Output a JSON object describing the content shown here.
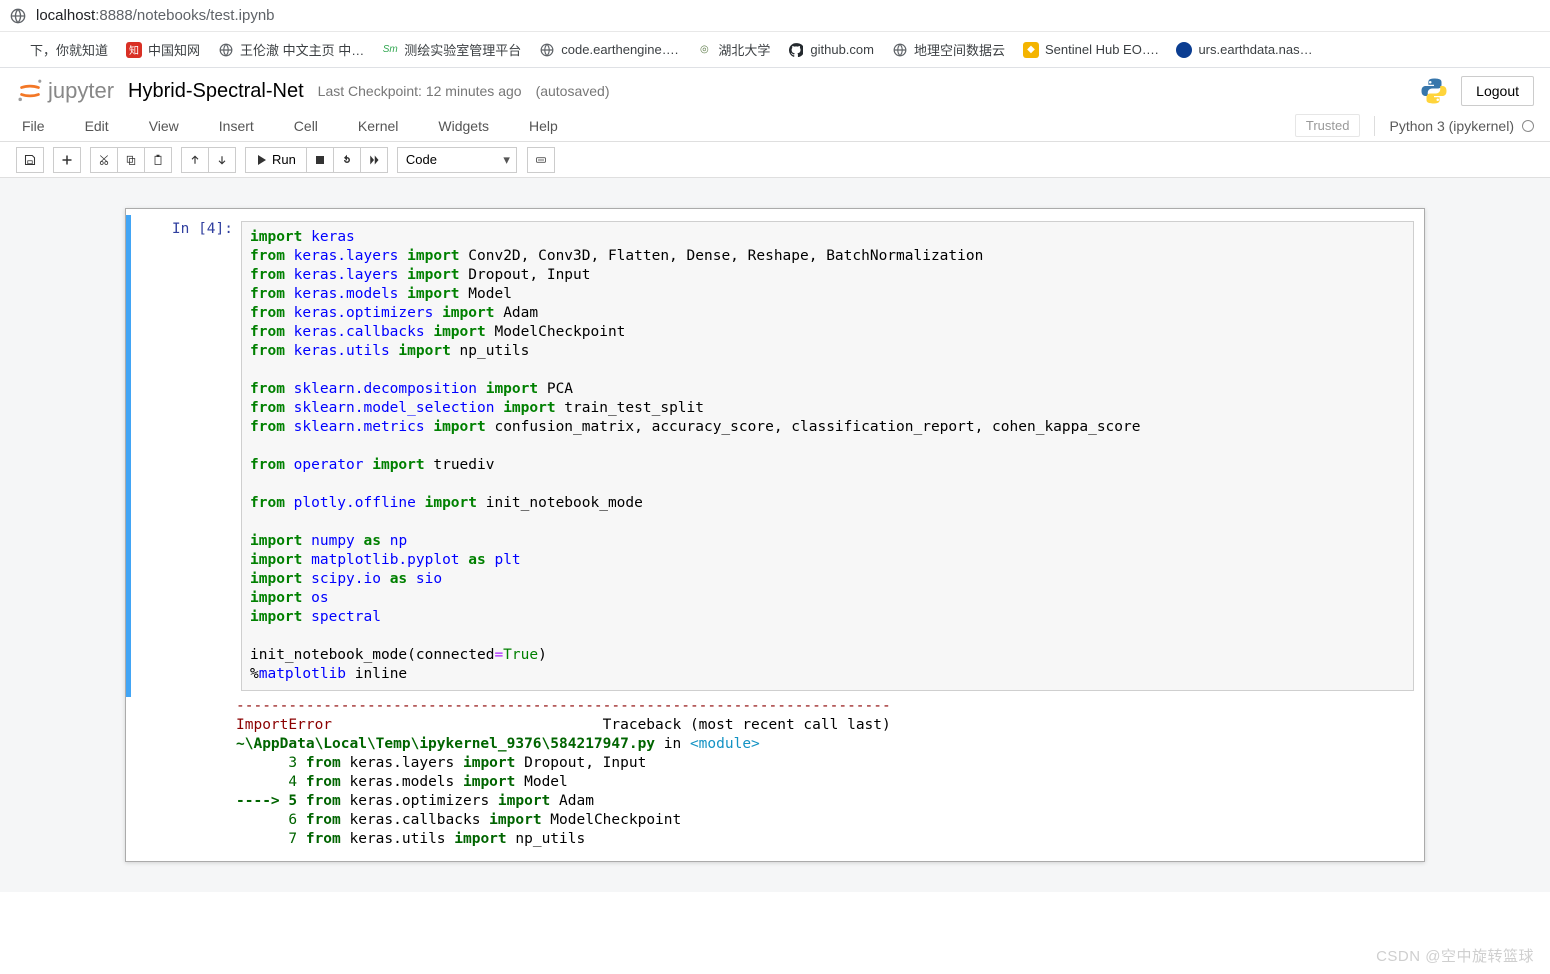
{
  "address": {
    "globe": "globe-icon",
    "url_prefix": "localhost",
    "url_rest": ":8888/notebooks/test.ipynb"
  },
  "bookmarks": [
    {
      "icon": "",
      "label": "下，你就知道"
    },
    {
      "icon": "知",
      "k": "red",
      "label": "中国知网"
    },
    {
      "icon": "gl",
      "k": "gl",
      "label": "王伦澈 中文主页 中…"
    },
    {
      "icon": "Sm",
      "k": "green",
      "label": "测绘实验室管理平台"
    },
    {
      "icon": "gl",
      "k": "gl",
      "label": "code.earthengine…."
    },
    {
      "icon": "◎",
      "k": "hbu",
      "label": "湖北大学"
    },
    {
      "icon": "gh",
      "k": "gh",
      "label": "github.com"
    },
    {
      "icon": "gl",
      "k": "gl",
      "label": "地理空间数据云"
    },
    {
      "icon": "◆",
      "k": "orange",
      "label": "Sentinel Hub EO…."
    },
    {
      "icon": "",
      "k": "nasa",
      "label": "urs.earthdata.nas…"
    }
  ],
  "header": {
    "logo": "jupyter",
    "title": "Hybrid-Spectral-Net",
    "checkpoint": "Last Checkpoint: 12 minutes ago",
    "autosave": "(autosaved)",
    "logout": "Logout"
  },
  "menu": [
    "File",
    "Edit",
    "View",
    "Insert",
    "Cell",
    "Kernel",
    "Widgets",
    "Help"
  ],
  "menu_right": {
    "trusted": "Trusted",
    "kernel": "Python 3 (ipykernel)"
  },
  "toolbar": {
    "run": "Run",
    "celltype": "Code"
  },
  "cell": {
    "prompt": "In [4]:",
    "code_raw": "import keras\nfrom keras.layers import Conv2D, Conv3D, Flatten, Dense, Reshape, BatchNormalization\nfrom keras.layers import Dropout, Input\nfrom keras.models import Model\nfrom keras.optimizers import Adam\nfrom keras.callbacks import ModelCheckpoint\nfrom keras.utils import np_utils\n\nfrom sklearn.decomposition import PCA\nfrom sklearn.model_selection import train_test_split\nfrom sklearn.metrics import confusion_matrix, accuracy_score, classification_report, cohen_kappa_score\n\nfrom operator import truediv\n\nfrom plotly.offline import init_notebook_mode\n\nimport numpy as np\nimport matplotlib.pyplot as plt\nimport scipy.io as sio\nimport os\nimport spectral\n\ninit_notebook_mode(connected=True)\n%matplotlib inline",
    "code_html": "<span class=\"kw\">import</span> <span class=\"nn\">keras</span>\n<span class=\"kw\">from</span> <span class=\"nn\">keras.layers</span> <span class=\"kw\">import</span> Conv2D, Conv3D, Flatten, Dense, Reshape, BatchNormalization\n<span class=\"kw\">from</span> <span class=\"nn\">keras.layers</span> <span class=\"kw\">import</span> Dropout, Input\n<span class=\"kw\">from</span> <span class=\"nn\">keras.models</span> <span class=\"kw\">import</span> Model\n<span class=\"kw\">from</span> <span class=\"nn\">keras.optimizers</span> <span class=\"kw\">import</span> Adam\n<span class=\"kw\">from</span> <span class=\"nn\">keras.callbacks</span> <span class=\"kw\">import</span> ModelCheckpoint\n<span class=\"kw\">from</span> <span class=\"nn\">keras.utils</span> <span class=\"kw\">import</span> np_utils\n\n<span class=\"kw\">from</span> <span class=\"nn\">sklearn.decomposition</span> <span class=\"kw\">import</span> PCA\n<span class=\"kw\">from</span> <span class=\"nn\">sklearn.model_selection</span> <span class=\"kw\">import</span> train_test_split\n<span class=\"kw\">from</span> <span class=\"nn\">sklearn.metrics</span> <span class=\"kw\">import</span> confusion_matrix, accuracy_score, classification_report, cohen_kappa_score\n\n<span class=\"kw\">from</span> <span class=\"nn\">operator</span> <span class=\"kw\">import</span> truediv\n\n<span class=\"kw\">from</span> <span class=\"nn\">plotly.offline</span> <span class=\"kw\">import</span> init_notebook_mode\n\n<span class=\"kw\">import</span> <span class=\"nn\">numpy</span> <span class=\"kw\">as</span> <span class=\"nn\">np</span>\n<span class=\"kw\">import</span> <span class=\"nn\">matplotlib.pyplot</span> <span class=\"kw\">as</span> <span class=\"nn\">plt</span>\n<span class=\"kw\">import</span> <span class=\"nn\">scipy.io</span> <span class=\"kw\">as</span> <span class=\"nn\">sio</span>\n<span class=\"kw\">import</span> <span class=\"nn\">os</span>\n<span class=\"kw\">import</span> <span class=\"nn\">spectral</span>\n\ninit_notebook_mode(connected<span class=\"op\">=</span><span class=\"tt\">True</span>)\n%<span class=\"nn\">matplotlib</span> inline"
  },
  "output": {
    "raw": "---------------------------------------------------------------------------\nImportError                               Traceback (most recent call last)\n~\\AppData\\Local\\Temp\\ipykernel_9376\\584217947.py in <module>\n      3 from keras.layers import Dropout, Input\n      4 from keras.models import Model\n----> 5 from keras.optimizers import Adam\n      6 from keras.callbacks import ModelCheckpoint\n      7 from keras.utils import np_utils",
    "html": "<span class=\"ansi-red\">---------------------------------------------------------------------------</span>\n<span class=\"ansi-red\">ImportError</span>                               Traceback (most recent call last)\n<span class=\"ansi-grn\">~\\AppData\\Local\\Temp\\ipykernel_9376\\584217947.py</span> in <span class=\"ansi-cy\">&lt;module&gt;</span>\n<span class=\"ansi-grn-n\">      3</span> <span class=\"ansi-grn\">from</span> keras.layers <span class=\"ansi-grn\">import</span> Dropout, Input\n<span class=\"ansi-grn-n\">      4</span> <span class=\"ansi-grn\">from</span> keras.models <span class=\"ansi-grn\">import</span> Model\n<span class=\"ansi-grn\">----&gt; 5</span> <span class=\"ansi-grn\">from</span> keras.optimizers <span class=\"ansi-grn\">import</span> Adam\n<span class=\"ansi-grn-n\">      6</span> <span class=\"ansi-grn\">from</span> keras.callbacks <span class=\"ansi-grn\">import</span> ModelCheckpoint\n<span class=\"ansi-grn-n\">      7</span> <span class=\"ansi-grn\">from</span> keras.utils <span class=\"ansi-grn\">import</span> np_utils"
  },
  "watermark": "CSDN @空中旋转篮球"
}
